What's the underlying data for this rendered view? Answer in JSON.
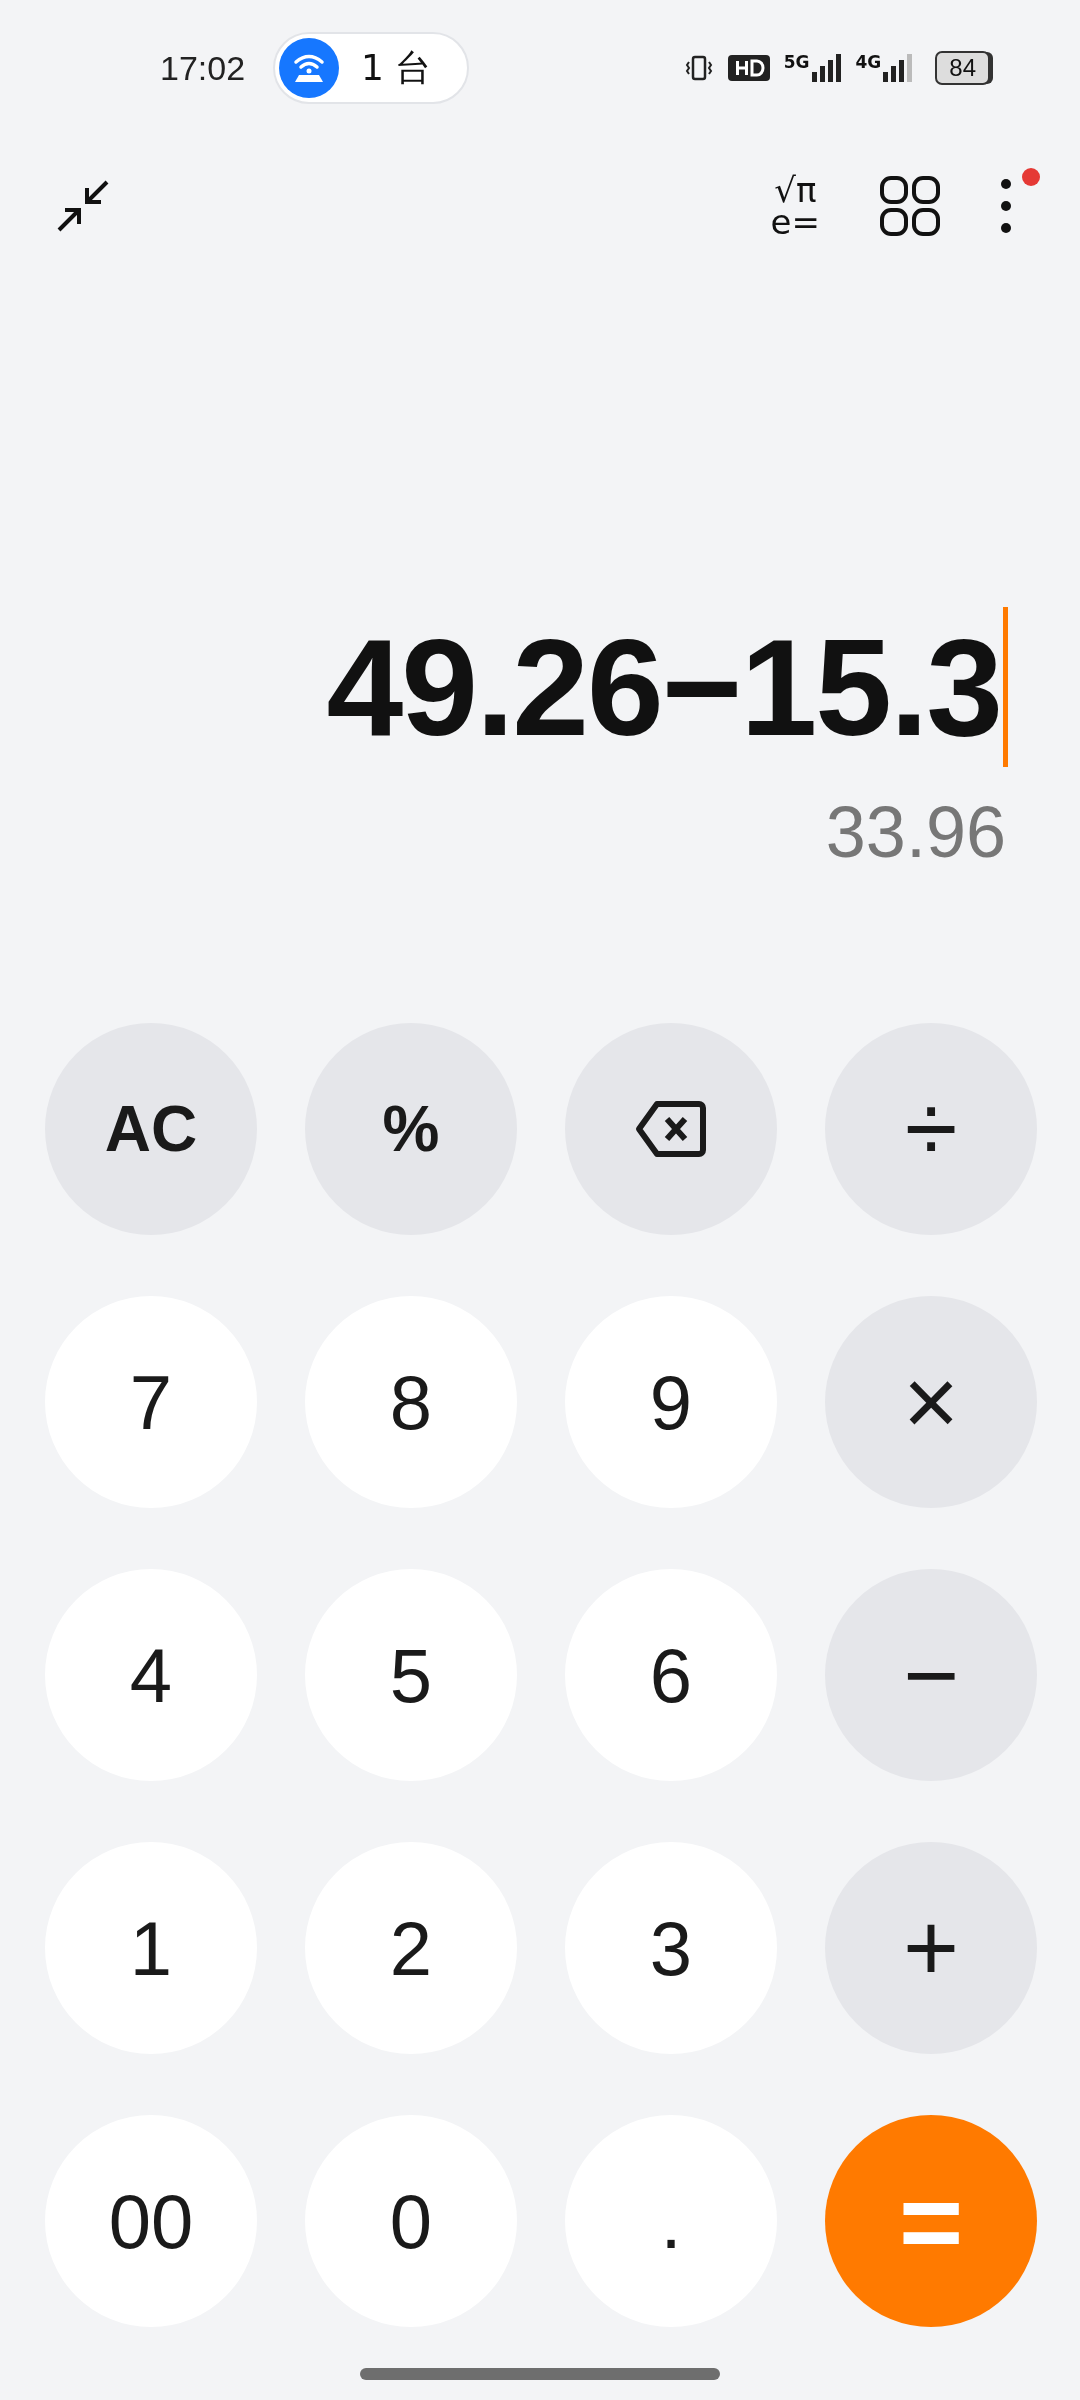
{
  "status_bar": {
    "time": "17:02",
    "hotspot": {
      "label": "1 台"
    },
    "network_1": "5G",
    "network_2": "4G",
    "battery": "84"
  },
  "toolbar": {
    "scientific": {
      "top": "√π",
      "bottom": "e="
    },
    "menu_badge": true
  },
  "display": {
    "expression": "49.26−15.3",
    "result": "33.96"
  },
  "keys": [
    {
      "kind": "function",
      "label": "AC"
    },
    {
      "kind": "function",
      "label": "%"
    },
    {
      "kind": "backspace"
    },
    {
      "kind": "operator",
      "label": "÷"
    },
    {
      "kind": "digit",
      "label": "7"
    },
    {
      "kind": "digit",
      "label": "8"
    },
    {
      "kind": "digit",
      "label": "9"
    },
    {
      "kind": "operator",
      "label": "×"
    },
    {
      "kind": "digit",
      "label": "4"
    },
    {
      "kind": "digit",
      "label": "5"
    },
    {
      "kind": "digit",
      "label": "6"
    },
    {
      "kind": "operator",
      "label": "−"
    },
    {
      "kind": "digit",
      "label": "1"
    },
    {
      "kind": "digit",
      "label": "2"
    },
    {
      "kind": "digit",
      "label": "3"
    },
    {
      "kind": "operator",
      "label": "+"
    },
    {
      "kind": "digit",
      "label": "00"
    },
    {
      "kind": "digit",
      "label": "0"
    },
    {
      "kind": "digit",
      "label": "."
    },
    {
      "kind": "equals",
      "label": "="
    }
  ]
}
